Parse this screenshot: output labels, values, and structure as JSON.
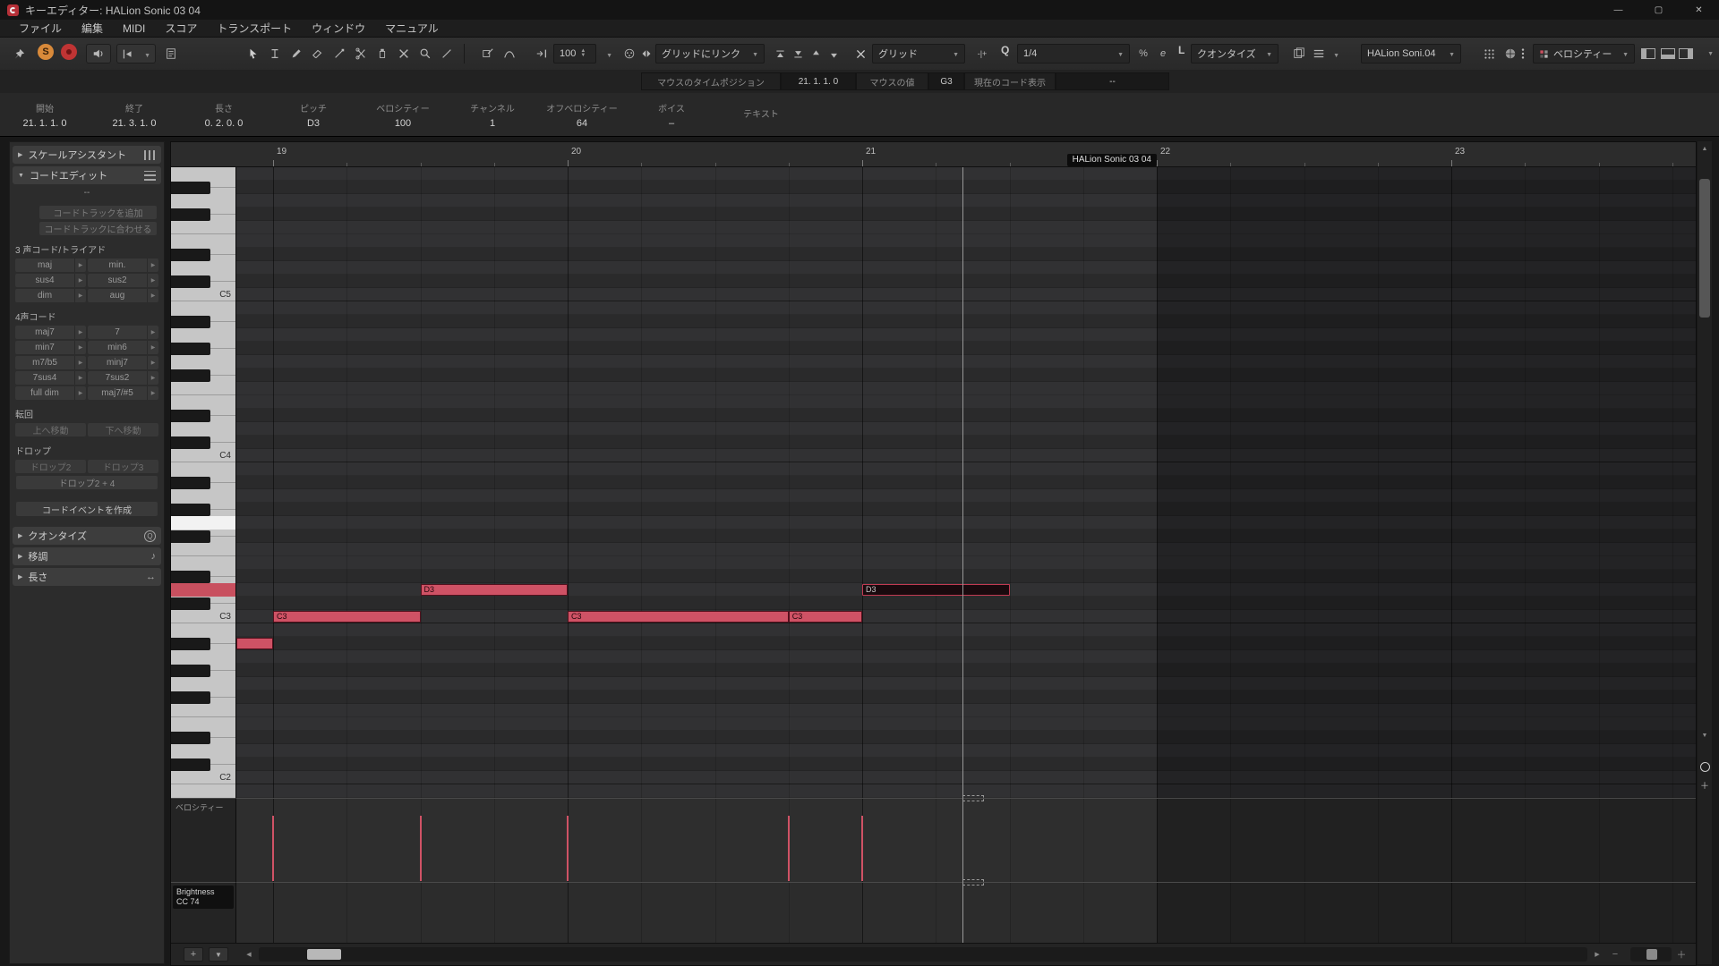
{
  "titlebar": {
    "title": "キーエディター: HALion Sonic 03 04",
    "minimize": "—",
    "maximize": "▢",
    "close": "✕"
  },
  "menubar": {
    "items": [
      "ファイル",
      "編集",
      "MIDI",
      "スコア",
      "トランスポート",
      "ウィンドウ",
      "マニュアル"
    ]
  },
  "toolbar": {
    "solo": "S",
    "insert_velocity": "100",
    "snap_type": "グリッドにリンク",
    "grid_type": "グリッド",
    "grid_rel": "-|+",
    "q_label": "Q",
    "quantize_preset": "1/4",
    "iterative_label": "%",
    "panel_label": "e",
    "length_q_label": "L",
    "length_quantize": "クオンタイズ",
    "part_selector": "HALion Soni.04",
    "event_colors": "ベロシティー"
  },
  "statusline": {
    "mouse_time_label": "マウスのタイムポジション",
    "mouse_time_value": "21. 1. 1. 0",
    "mouse_value_label": "マウスの値",
    "mouse_value": "G3",
    "chord_display_label": "現在のコード表示",
    "chord_display_value": "--"
  },
  "infoline": {
    "fields": [
      {
        "label": "開始",
        "value": "21. 1. 1. 0"
      },
      {
        "label": "終了",
        "value": "21. 3. 1. 0"
      },
      {
        "label": "長さ",
        "value": "0. 2. 0. 0"
      },
      {
        "label": "ピッチ",
        "value": "D3"
      },
      {
        "label": "ベロシティー",
        "value": "100"
      },
      {
        "label": "チャンネル",
        "value": "1"
      },
      {
        "label": "オフベロシティー",
        "value": "64"
      },
      {
        "label": "ボイス",
        "value": "–"
      },
      {
        "label": "テキスト",
        "value": ""
      }
    ]
  },
  "inspector": {
    "scale_assistant": {
      "label": "スケールアシスタント"
    },
    "chord_edit": {
      "label": "コードエディット",
      "current_chord": "--",
      "add_chord_track": "コードトラックを追加",
      "follow_chord_track": "コードトラックに合わせる",
      "triads_label": "3 声コード/トライアド",
      "triads": [
        [
          "maj",
          "min."
        ],
        [
          "sus4",
          "sus2"
        ],
        [
          "dim",
          "aug"
        ]
      ],
      "four_note_label": "4声コード",
      "four_note": [
        [
          "maj7",
          "7"
        ],
        [
          "min7",
          "min6"
        ],
        [
          "m7/b5",
          "minj7"
        ],
        [
          "7sus4",
          "7sus2"
        ],
        [
          "full dim",
          "maj7/#5"
        ]
      ],
      "inversion_label": "転回",
      "inversions": [
        "上へ移動",
        "下へ移動"
      ],
      "drop_label": "ドロップ",
      "drops": [
        "ドロップ2",
        "ドロップ3"
      ],
      "drop_wide": "ドロップ2 + 4",
      "create_chord_event": "コードイベントを作成"
    },
    "quantize_label": "クオンタイズ",
    "transpose_label": "移調",
    "length_label": "長さ"
  },
  "ruler": {
    "measures": [
      19,
      20,
      21,
      22,
      23
    ]
  },
  "part_label": "HALion Sonic 03 04",
  "piano": {
    "octave_labels": [
      "C5",
      "C4",
      "C3",
      "C2"
    ],
    "highlighted_keys": [
      {
        "pitch": "D3",
        "color": "#c8505f"
      },
      {
        "pitch": "G3",
        "color": "#f2f2f2"
      }
    ]
  },
  "grid": {
    "measure_start": 19,
    "measure_end": 23,
    "beats_per_measure": 4,
    "part_end_measure": 22,
    "playhead_measure": 21.34,
    "top_pitch": "A5",
    "bottom_pitch": "B1"
  },
  "notes": [
    {
      "pitch": "A#2",
      "start": 18.875,
      "end": 19.0,
      "label": "",
      "selected": false
    },
    {
      "pitch": "C3",
      "start": 19.0,
      "end": 19.5,
      "label": "C3",
      "selected": false
    },
    {
      "pitch": "D3",
      "start": 19.5,
      "end": 20.0,
      "label": "D3",
      "selected": false
    },
    {
      "pitch": "C3",
      "start": 20.0,
      "end": 20.75,
      "label": "C3",
      "selected": false
    },
    {
      "pitch": "C3",
      "start": 20.75,
      "end": 21.0,
      "label": "C3",
      "selected": false
    },
    {
      "pitch": "D3",
      "start": 21.0,
      "end": 21.5,
      "label": "D3",
      "selected": true
    }
  ],
  "velocity_lane": {
    "label": "ベロシティー",
    "bars": [
      19.0,
      19.5,
      20.0,
      20.75,
      21.0
    ],
    "bar_height_pct": 78
  },
  "cc_lane": {
    "name": "Brightness",
    "number": "CC 74"
  },
  "scrollbars": {
    "add": "+",
    "lane_menu": "▼",
    "left": "◀",
    "right": "▶",
    "up": "▲",
    "down": "▼",
    "zoom_out": "−",
    "zoom_in": "＋"
  }
}
